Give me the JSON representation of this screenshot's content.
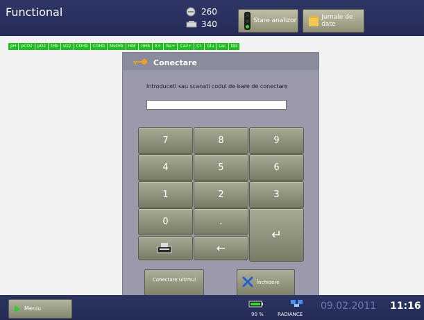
{
  "header": {
    "title": "Functional",
    "counter_top": "260",
    "counter_bottom": "340",
    "status_button_label": "Stare analizor",
    "journals_button_label": "Jurnale de date"
  },
  "parameters": [
    "pH",
    "pCO2",
    "pO2",
    "tHb",
    "sO2",
    "COHb",
    "COHb",
    "MetHb",
    "HbF",
    "HHb",
    "K+",
    "Na+",
    "Ca2+",
    "Cl-",
    "Glu",
    "Lac",
    "tBil"
  ],
  "dialog": {
    "title": "Conectare",
    "prompt": "Introduceti sau scanati codul de bare de conectare",
    "input_value": "",
    "keys": {
      "k7": "7",
      "k8": "8",
      "k9": "9",
      "k4": "4",
      "k5": "5",
      "k6": "6",
      "k1": "1",
      "k2": "2",
      "k3": "3",
      "k0": "0",
      "dot": ".",
      "enter": "↵",
      "backspace": "←"
    },
    "connect_last_label": "Conectare ultimul",
    "close_label": "Închidere"
  },
  "footer": {
    "menu_label": "Meniu",
    "battery": "90 %",
    "device_name": "RADIANCE",
    "date": "09.02.2011",
    "time": "11:16"
  },
  "colors": {
    "bar": "#2a3160",
    "param_green": "#1fbf1f",
    "dialog_bg": "#9a9aac"
  }
}
